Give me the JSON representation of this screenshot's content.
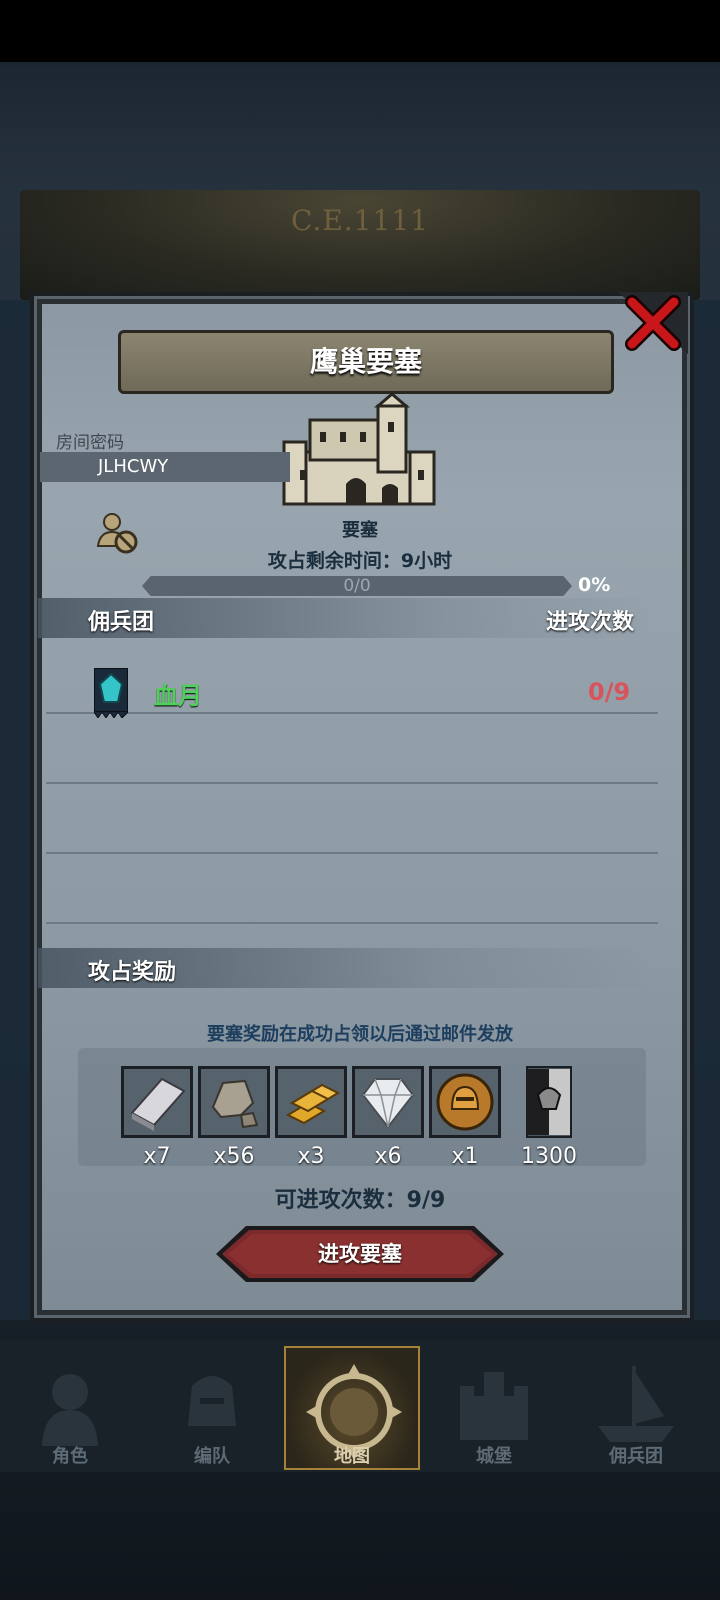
{
  "header": {
    "era_label": "C.E.1111"
  },
  "dialog": {
    "title": "鹰巢要塞",
    "close_icon": "close-x-icon",
    "room_password_label": "房间密码",
    "room_password_value": "JLHCWY",
    "building_type": "要塞",
    "time_remaining": "攻占剩余时间：9小时",
    "progress": {
      "text": "0/0",
      "percent_text": "0%",
      "fraction": 0
    },
    "mercenary_section": {
      "title": "佣兵团",
      "column_label": "进攻次数"
    },
    "mercenaries": [
      {
        "name": "血月",
        "attack_count": "0/9",
        "name_color": "#4fd05a",
        "count_color": "#d8545c"
      }
    ],
    "reward_section": {
      "title": "攻占奖励",
      "note": "要塞奖励在成功占领以后通过邮件发放",
      "items": [
        {
          "icon": "iron-ingot-icon",
          "qty": "x7"
        },
        {
          "icon": "stone-ore-icon",
          "qty": "x56"
        },
        {
          "icon": "gold-bars-icon",
          "qty": "x3"
        },
        {
          "icon": "diamond-icon",
          "qty": "x6"
        },
        {
          "icon": "knight-helmet-coin-icon",
          "qty": "x1"
        },
        {
          "icon": "war-banner-icon",
          "qty": "1300"
        }
      ]
    },
    "attack_count_text": "可进攻次数：9/9",
    "attack_button_label": "进攻要塞"
  },
  "bottom_nav": {
    "items": [
      {
        "label": "角色",
        "icon": "character-icon",
        "active": false
      },
      {
        "label": "编队",
        "icon": "formation-icon",
        "active": false
      },
      {
        "label": "地图",
        "icon": "map-compass-icon",
        "active": true
      },
      {
        "label": "城堡",
        "icon": "castle-icon",
        "active": false
      },
      {
        "label": "佣兵团",
        "icon": "mercenary-ship-icon",
        "active": false
      }
    ]
  }
}
